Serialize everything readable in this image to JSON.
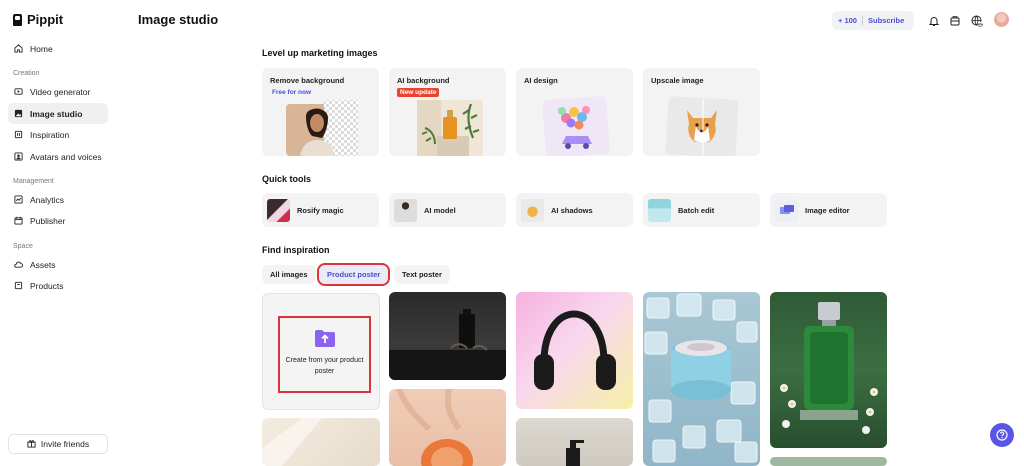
{
  "app": {
    "name": "Pippit"
  },
  "sidebar": {
    "items": [
      {
        "label": "Home",
        "icon": "home-icon"
      },
      {
        "label": "Video generator",
        "icon": "video-icon"
      },
      {
        "label": "Image studio",
        "icon": "image-icon"
      },
      {
        "label": "Inspiration",
        "icon": "lightbulb-icon"
      },
      {
        "label": "Avatars and voices",
        "icon": "avatar-icon"
      },
      {
        "label": "Analytics",
        "icon": "analytics-icon"
      },
      {
        "label": "Publisher",
        "icon": "calendar-icon"
      },
      {
        "label": "Assets",
        "icon": "cloud-icon"
      },
      {
        "label": "Products",
        "icon": "box-icon"
      }
    ],
    "sections": {
      "creation": "Creation",
      "management": "Management",
      "space": "Space"
    },
    "invite_label": "Invite friends",
    "active": "Image studio"
  },
  "header": {
    "title": "Image studio",
    "credits": "+ 100",
    "subscribe": "Subscribe"
  },
  "main": {
    "level_up_heading": "Level up marketing images",
    "features": [
      {
        "title": "Remove background",
        "badge": "Free for now"
      },
      {
        "title": "AI background",
        "badge": "New update"
      },
      {
        "title": "AI design",
        "badge": ""
      },
      {
        "title": "Upscale image",
        "badge": ""
      }
    ],
    "quick_tools_heading": "Quick tools",
    "quick_tools": [
      {
        "label": "Rosify magic"
      },
      {
        "label": "AI model"
      },
      {
        "label": "AI shadows"
      },
      {
        "label": "Batch edit"
      },
      {
        "label": "Image editor"
      }
    ],
    "inspiration_heading": "Find inspiration",
    "tabs": [
      {
        "label": "All images"
      },
      {
        "label": "Product poster"
      },
      {
        "label": "Text poster"
      }
    ],
    "active_tab": "Product poster",
    "create_card": "Create from your product poster"
  },
  "colors": {
    "accent": "#4a4fd0",
    "highlight": "#d8363a",
    "help_button": "#5a55e6",
    "new_badge": "#e8452f"
  }
}
